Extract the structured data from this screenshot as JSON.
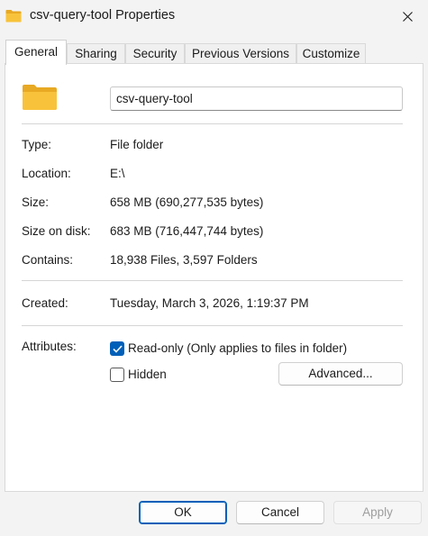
{
  "window": {
    "title": "csv-query-tool Properties",
    "close_icon": "close-icon",
    "folder_icon": "folder-icon"
  },
  "tabs": [
    {
      "label": "General",
      "active": true
    },
    {
      "label": "Sharing",
      "active": false
    },
    {
      "label": "Security",
      "active": false
    },
    {
      "label": "Previous Versions",
      "active": false
    },
    {
      "label": "Customize",
      "active": false
    }
  ],
  "general": {
    "folder_name": "csv-query-tool",
    "type": {
      "label": "Type:",
      "value": "File folder"
    },
    "location": {
      "label": "Location:",
      "value": "E:\\"
    },
    "size": {
      "label": "Size:",
      "value": "658 MB (690,277,535 bytes)"
    },
    "size_on_disk": {
      "label": "Size on disk:",
      "value": "683 MB (716,447,744 bytes)"
    },
    "contains": {
      "label": "Contains:",
      "value": "18,938 Files, 3,597 Folders"
    },
    "created": {
      "label": "Created:",
      "value": "Tuesday, March 3, 2026, 1:19:37 PM"
    },
    "attributes": {
      "label": "Attributes:",
      "read_only": {
        "label": "Read-only (Only applies to files in folder)",
        "checked": true
      },
      "hidden": {
        "label": "Hidden",
        "checked": false
      },
      "advanced_button": "Advanced..."
    }
  },
  "buttons": {
    "ok": "OK",
    "cancel": "Cancel",
    "apply": "Apply"
  },
  "colors": {
    "accent": "#005fb8",
    "folder": "#f8c33b"
  }
}
